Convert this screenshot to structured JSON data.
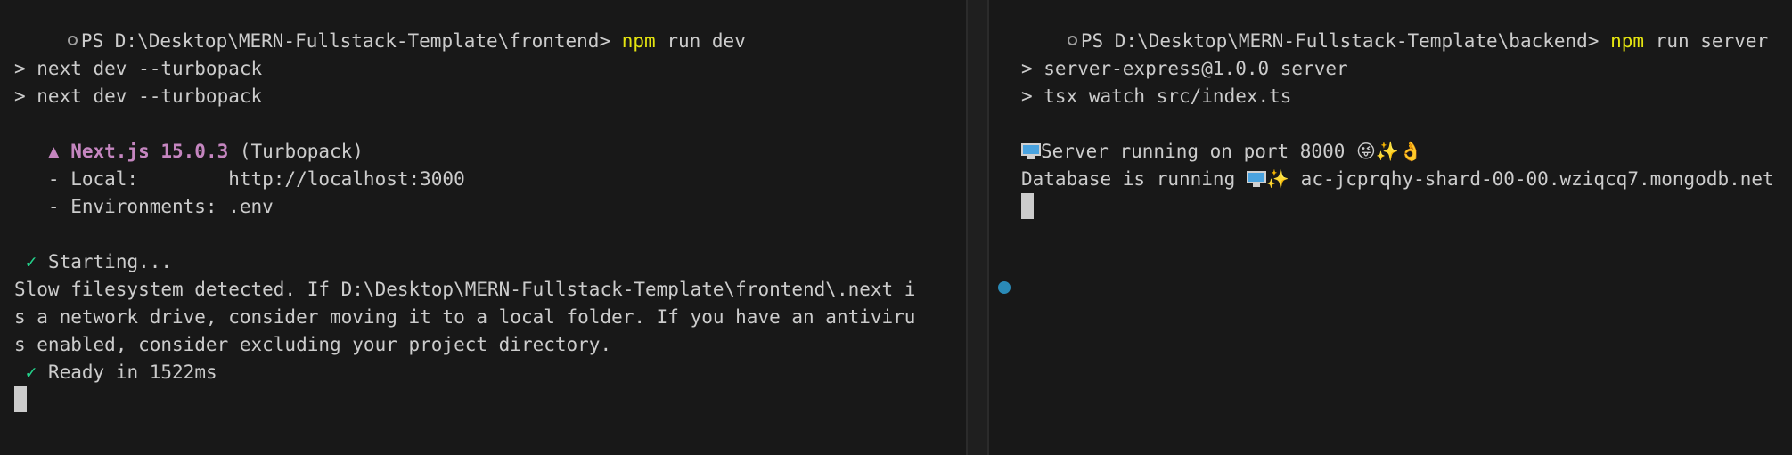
{
  "left": {
    "prompt": "PS D:\\Desktop\\MERN-Fullstack-Template\\frontend>",
    "command": "npm",
    "command_args": " run dev",
    "lines": [
      "> next dev --turbopack",
      "> next dev --turbopack"
    ],
    "next_brand": "▲ Next.js 15.0.3",
    "next_mode": " (Turbopack)",
    "local_line": "   - Local:        http://localhost:3000",
    "env_line": "   - Environments: .env",
    "check_glyph": "✓",
    "starting": " Starting...",
    "warn": [
      "Slow filesystem detected. If D:\\Desktop\\MERN-Fullstack-Template\\frontend\\.next i",
      "s a network drive, consider moving it to a local folder. If you have an antiviru",
      "s enabled, consider excluding your project directory."
    ],
    "ready": " Ready in 1522ms"
  },
  "right": {
    "prompt": "PS D:\\Desktop\\MERN-Fullstack-Template\\backend>",
    "command": "npm",
    "command_args": " run server",
    "lines": [
      "> server-express@1.0.0 server",
      "> tsx watch src/index.ts"
    ],
    "server_text": "Server running on port 8000 ",
    "server_emojis": "😜✨👌",
    "db_text": "Database is running ",
    "db_emoji": "✨",
    "db_host": " ac-jcprqhy-shard-00-00.wziqcq7.mongodb.net"
  },
  "icons": {
    "prompt_circle": "circle-outline-icon",
    "monitor": "monitor-icon",
    "status_dot": "status-dot-icon"
  },
  "colors": {
    "background": "#181818",
    "text": "#cccccc",
    "command": "#e5e510",
    "next_brand": "#c586c0",
    "check": "#23d18b",
    "dot": "#2a8ab7"
  }
}
